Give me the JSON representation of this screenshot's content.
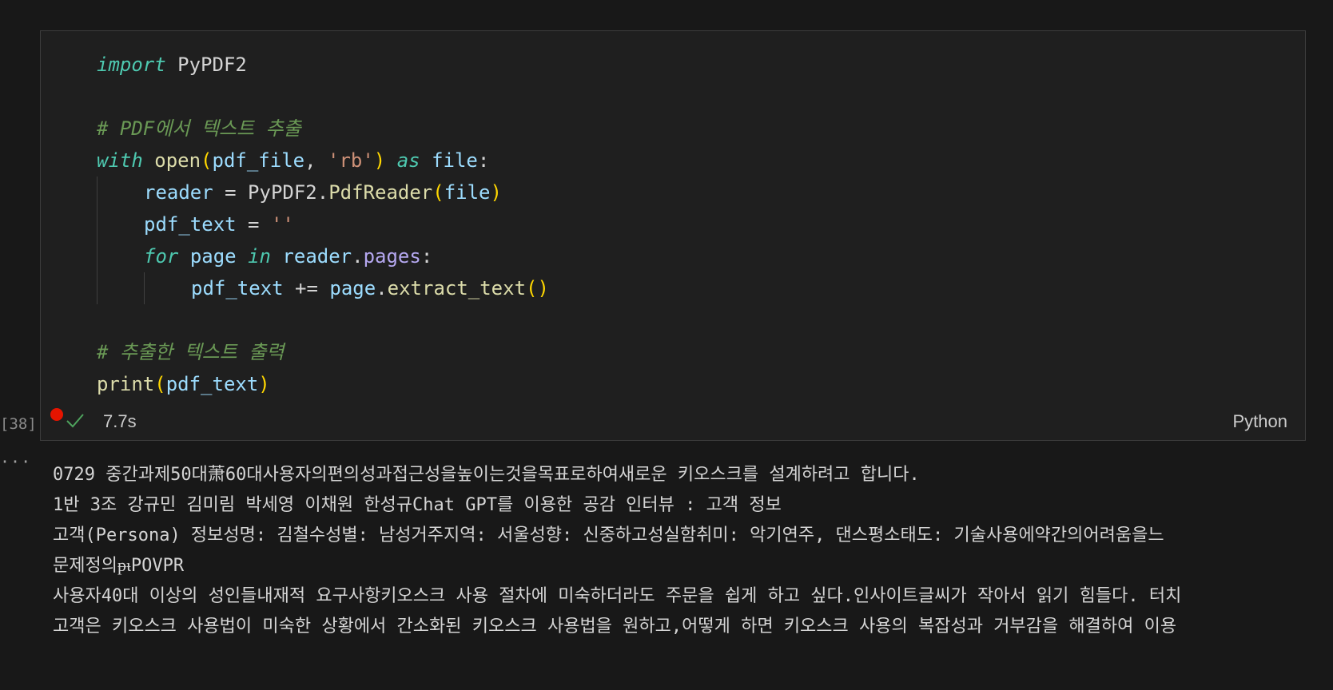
{
  "cell": {
    "execution_count": "[38]",
    "duration": "7.7s",
    "language": "Python",
    "code_lines": [
      {
        "indent": 0,
        "tokens": [
          {
            "c": "kw",
            "t": "import"
          },
          {
            "c": "plain",
            "t": " PyPDF2"
          }
        ]
      },
      {
        "indent": 0,
        "tokens": []
      },
      {
        "indent": 0,
        "tokens": [
          {
            "c": "cmt",
            "t": "# PDF에서 텍스트 추출"
          }
        ]
      },
      {
        "indent": 0,
        "tokens": [
          {
            "c": "kw",
            "t": "with"
          },
          {
            "c": "plain",
            "t": " "
          },
          {
            "c": "fn",
            "t": "open"
          },
          {
            "c": "paren",
            "t": "("
          },
          {
            "c": "var",
            "t": "pdf_file"
          },
          {
            "c": "plain",
            "t": ", "
          },
          {
            "c": "str",
            "t": "'rb'"
          },
          {
            "c": "paren",
            "t": ")"
          },
          {
            "c": "plain",
            "t": " "
          },
          {
            "c": "kw",
            "t": "as"
          },
          {
            "c": "plain",
            "t": " "
          },
          {
            "c": "var",
            "t": "file"
          },
          {
            "c": "plain",
            "t": ":"
          }
        ]
      },
      {
        "indent": 1,
        "tokens": [
          {
            "c": "var",
            "t": "reader"
          },
          {
            "c": "plain",
            "t": " = PyPDF2."
          },
          {
            "c": "cls",
            "t": "PdfReader"
          },
          {
            "c": "paren",
            "t": "("
          },
          {
            "c": "var",
            "t": "file"
          },
          {
            "c": "paren",
            "t": ")"
          }
        ]
      },
      {
        "indent": 1,
        "tokens": [
          {
            "c": "var",
            "t": "pdf_text"
          },
          {
            "c": "plain",
            "t": " = "
          },
          {
            "c": "str",
            "t": "''"
          }
        ]
      },
      {
        "indent": 1,
        "tokens": [
          {
            "c": "kw",
            "t": "for"
          },
          {
            "c": "plain",
            "t": " "
          },
          {
            "c": "var",
            "t": "page"
          },
          {
            "c": "plain",
            "t": " "
          },
          {
            "c": "kw",
            "t": "in"
          },
          {
            "c": "plain",
            "t": " "
          },
          {
            "c": "var",
            "t": "reader"
          },
          {
            "c": "plain",
            "t": "."
          },
          {
            "c": "prop",
            "t": "pages"
          },
          {
            "c": "plain",
            "t": ":"
          }
        ]
      },
      {
        "indent": 2,
        "tokens": [
          {
            "c": "var",
            "t": "pdf_text"
          },
          {
            "c": "plain",
            "t": " += "
          },
          {
            "c": "var",
            "t": "page"
          },
          {
            "c": "plain",
            "t": "."
          },
          {
            "c": "fn",
            "t": "extract_text"
          },
          {
            "c": "paren",
            "t": "()"
          }
        ]
      },
      {
        "indent": 0,
        "tokens": []
      },
      {
        "indent": 0,
        "tokens": [
          {
            "c": "cmt",
            "t": "# 추출한 텍스트 출력"
          }
        ]
      },
      {
        "indent": 0,
        "tokens": [
          {
            "c": "fn",
            "t": "print"
          },
          {
            "c": "paren",
            "t": "("
          },
          {
            "c": "var",
            "t": "pdf_text"
          },
          {
            "c": "paren",
            "t": ")"
          }
        ]
      }
    ]
  },
  "output": {
    "more_indicator": "···",
    "lines": [
      "0729 중간과제50대萧60대사용자의편의성과접근성을높이는것을목표로하여새로운 키오스크를 설계하려고 합니다.",
      "1반 3조 강규민 김미림 박세영 이채원 한성규Chat GPT를 이용한 공감 인터뷰 : 고객 정보",
      "고객(Persona) 정보성명: 김철수성별: 남성거주지역: 서울성향: 신중하고성실함취미: 악기연주, 댄스평소태도: 기술사용에약간의어려움을느",
      "문제정의ᵽᵼPOVPR",
      "사용자40대 이상의 성인들내재적 요구사항키오스크 사용 절차에 미숙하더라도 주문을 쉽게 하고 싶다.인사이트글씨가 작아서 읽기 힘들다. 터치",
      "고객은 키오스크 사용법이 미숙한 상황에서 간소화된 키오스크 사용법을 원하고,어떻게 하면 키오스크 사용의 복잡성과 거부감을 해결하여 이용"
    ]
  }
}
